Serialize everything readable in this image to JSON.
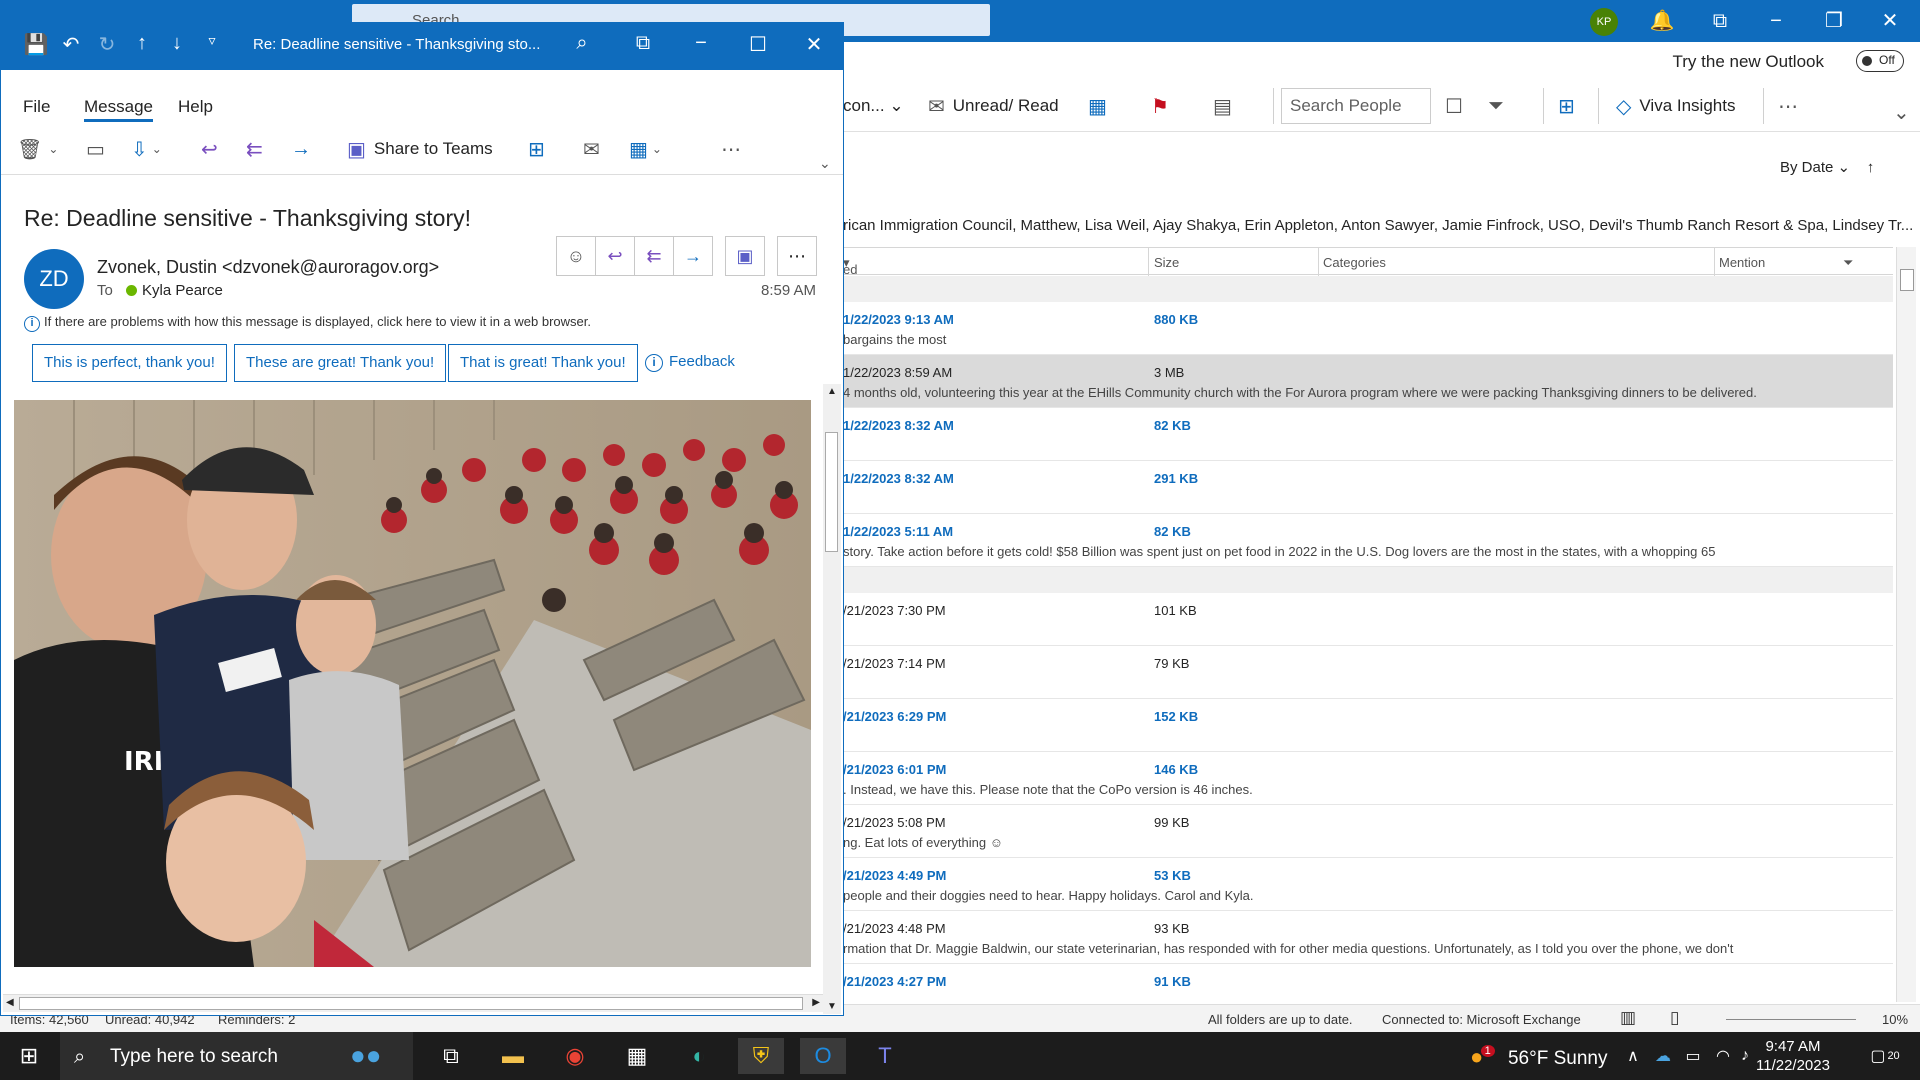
{
  "main": {
    "search_placeholder": "Search",
    "avatar_initials": "KP",
    "try_new_outlook": "Try the new Outlook",
    "toggle_label": "Off",
    "ribbon": {
      "partial_label": "con...",
      "unread_read": "Unread/ Read",
      "search_people_placeholder": "Search People",
      "viva_insights": "Viva Insights"
    },
    "sort_label": "By Date",
    "recipients_line": "rican Immigration Council, Matthew, Lisa Weil, Ajay Shakya, Erin Appleton, Anton Sawyer, Jamie Finfrock, USO, Devil's Thumb Ranch Resort & Spa, Lindsey Tr...",
    "columns": {
      "received": "ed",
      "size": "Size",
      "categories": "Categories",
      "mention": "Mention"
    },
    "messages": [
      {
        "date": "1/22/2023 9:13 AM",
        "size": "880 KB",
        "preview": " bargains the most",
        "unread": true,
        "selected": false
      },
      {
        "date": "1/22/2023 8:59 AM",
        "size": "3 MB",
        "preview": "4 months old, volunteering this year at the EHills Community church with the For Aurora program where we were packing Thanksgiving dinners to be delivered.",
        "unread": false,
        "selected": true
      },
      {
        "date": "1/22/2023 8:32 AM",
        "size": "82 KB",
        "preview": "",
        "unread": true,
        "selected": false
      },
      {
        "date": "1/22/2023 8:32 AM",
        "size": "291 KB",
        "preview": "",
        "unread": true,
        "selected": false
      },
      {
        "date": "1/22/2023 5:11 AM",
        "size": "82 KB",
        "preview": "story. Take action before it gets cold!   $58 Billion was spent just on pet food in 2022 in the U.S. Dog lovers are the most in the states, with a whopping 65",
        "unread": true,
        "selected": false
      },
      {
        "date": "/21/2023 7:30 PM",
        "size": "101 KB",
        "preview": "",
        "unread": false,
        "selected": false
      },
      {
        "date": "/21/2023 7:14 PM",
        "size": "79 KB",
        "preview": "",
        "unread": false,
        "selected": false
      },
      {
        "date": "/21/2023 6:29 PM",
        "size": "152 KB",
        "preview": "",
        "unread": true,
        "selected": false
      },
      {
        "date": "/21/2023 6:01 PM",
        "size": "146 KB",
        "preview": ". Instead, we have this.  Please note that the CoPo version is 46 inches.",
        "unread": true,
        "selected": false
      },
      {
        "date": "/21/2023 5:08 PM",
        "size": "99 KB",
        "preview": "ng.  Eat lots of everything ☺",
        "unread": false,
        "selected": false
      },
      {
        "date": "/21/2023 4:49 PM",
        "size": "53 KB",
        "preview": " people and their doggies need to hear.  Happy holidays.  Carol and Kyla.",
        "unread": true,
        "selected": false
      },
      {
        "date": "/21/2023 4:48 PM",
        "size": "93 KB",
        "preview": "rmation that Dr. Maggie Baldwin, our state veterinarian, has responded with for other media questions. Unfortunately, as I told you over the phone, we don't",
        "unread": false,
        "selected": false
      },
      {
        "date": "/21/2023 4:27 PM",
        "size": "91 KB",
        "preview": "",
        "unread": true,
        "selected": false
      }
    ],
    "status": {
      "items": "Items: 42,560",
      "unread": "Unread: 40,942",
      "reminders": "Reminders: 2",
      "up_to_date": "All folders are up to date.",
      "connected": "Connected to: Microsoft Exchange",
      "zoom": "10%"
    }
  },
  "popup": {
    "window_title": "Re: Deadline sensitive - Thanksgiving sto...",
    "tabs": [
      "File",
      "Message",
      "Help"
    ],
    "share_to_teams": "Share to Teams",
    "subject": "Re: Deadline sensitive - Thanksgiving story!",
    "sender_initials": "ZD",
    "sender": "Zvonek, Dustin <dzvonek@auroragov.org>",
    "to_label": "To",
    "to_name": "Kyla Pearce",
    "time": "8:59 AM",
    "info_bar": "If there are problems with how this message is displayed, click here to view it in a web browser.",
    "suggested_replies": [
      "This is perfect, thank you!",
      "These are great! Thank you!",
      "That is great! Thank you!"
    ],
    "feedback": "Feedback",
    "photo_text": "IRM"
  },
  "taskbar": {
    "search_placeholder": "Type here to search",
    "weather": "56°F  Sunny",
    "time": "9:47 AM",
    "date": "11/22/2023",
    "notifications": "20",
    "weather_badge": "1"
  },
  "colors": {
    "accent": "#0f6cbd",
    "presence": "#6bb700",
    "purple_actions": "#7a4fbf"
  }
}
